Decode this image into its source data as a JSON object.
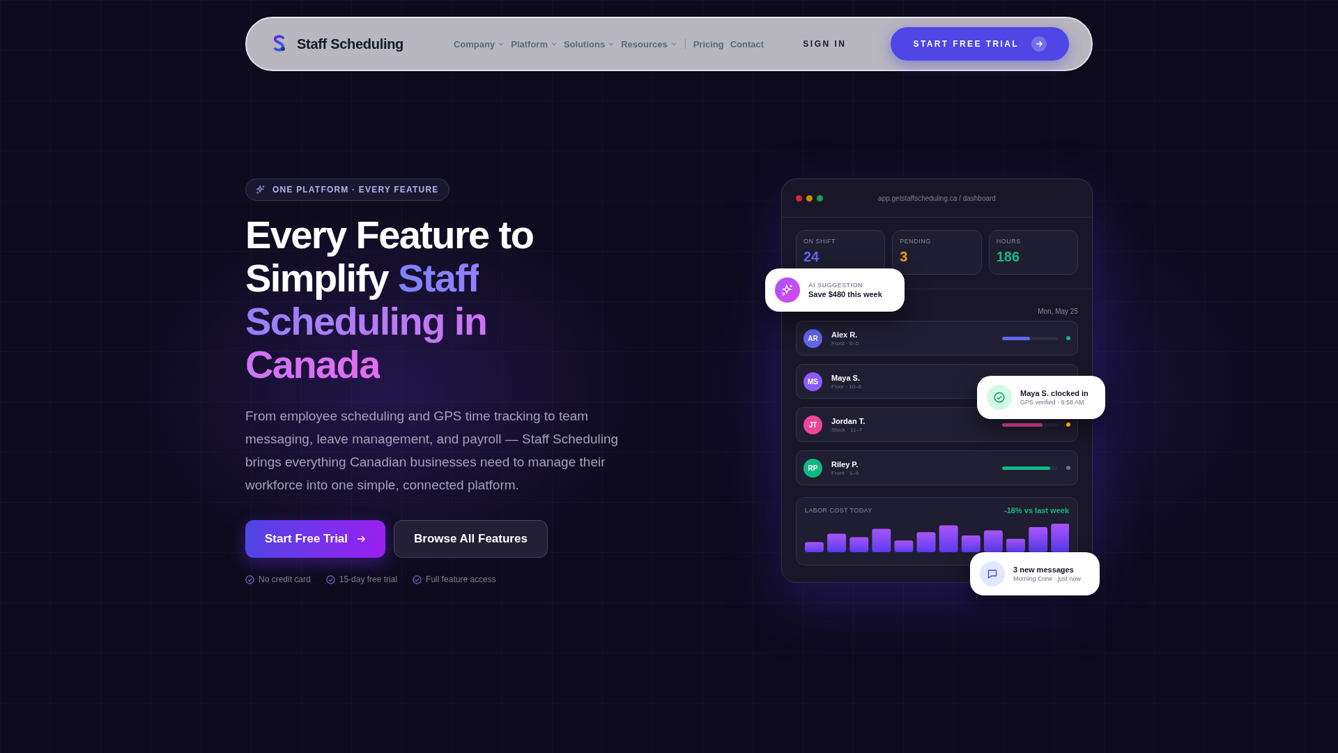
{
  "nav": {
    "brand": "Staff Scheduling",
    "links": [
      {
        "label": "Company",
        "dropdown": true
      },
      {
        "label": "Platform",
        "dropdown": true
      },
      {
        "label": "Solutions",
        "dropdown": true
      },
      {
        "label": "Resources",
        "dropdown": true
      },
      {
        "label": "Pricing",
        "dropdown": false
      },
      {
        "label": "Contact",
        "dropdown": false
      }
    ],
    "sign_in": "SIGN IN",
    "cta": "START FREE TRIAL"
  },
  "hero": {
    "badge": "ONE PLATFORM · EVERY FEATURE",
    "headline": [
      {
        "text": "Every Feature to Simplify ",
        "highlight": false
      },
      {
        "text": "Staff Scheduling in Canada",
        "highlight": true
      }
    ],
    "description": "From employee scheduling and GPS time tracking to team messaging, leave management, and payroll — Staff Scheduling brings everything Canadian businesses need to manage their workforce into one simple, connected platform.",
    "buttons": [
      {
        "label": "Start Free Trial",
        "kind": "primary"
      },
      {
        "label": "Browse All Features",
        "kind": "secondary"
      }
    ],
    "checks": [
      "No credit card",
      "15-day free trial",
      "Full feature access"
    ]
  },
  "dashboard": {
    "url": "app.getstaffscheduling.ca / dashboard",
    "stats": [
      {
        "label": "ON SHIFT",
        "value": "24",
        "color": "#6366f1"
      },
      {
        "label": "PENDING",
        "value": "3",
        "color": "#f59e0b"
      },
      {
        "label": "HOURS",
        "value": "186",
        "color": "#10b981"
      }
    ],
    "date": "Mon, May 25",
    "rows": [
      {
        "initials": "AR",
        "name": "Alex R.",
        "detail": "Front · 9–5",
        "color": "#6366f1",
        "level": 0.5,
        "status_dot": {
          "color": "#10b981"
        }
      },
      {
        "initials": "MS",
        "name": "Maya S.",
        "detail": "Floor · 10–6",
        "color": "#8b5cf6"
      },
      {
        "initials": "JT",
        "name": "Jordan T.",
        "detail": "Stock · 11–7",
        "color": "#ec4899",
        "level": 0.72,
        "status_dot": {
          "color": "#f59e0b"
        }
      },
      {
        "initials": "RP",
        "name": "Riley P.",
        "detail": "Front · 1–9",
        "color": "#10b981",
        "level": 0.86,
        "status_dot": {
          "color": "#6b7280"
        }
      }
    ],
    "labor": {
      "label": "LABOR COST TODAY",
      "change": "-18% vs last week"
    }
  },
  "toasts": [
    {
      "kind": "ai",
      "title": "AI SUGGESTION",
      "text": "Save $480 this week"
    },
    {
      "kind": "clock",
      "title": "Maya S. clocked in",
      "text": "GPS verified · 9:58 AM"
    },
    {
      "kind": "message",
      "title": "3 new messages",
      "text": "Morning Crew · just now"
    }
  ]
}
